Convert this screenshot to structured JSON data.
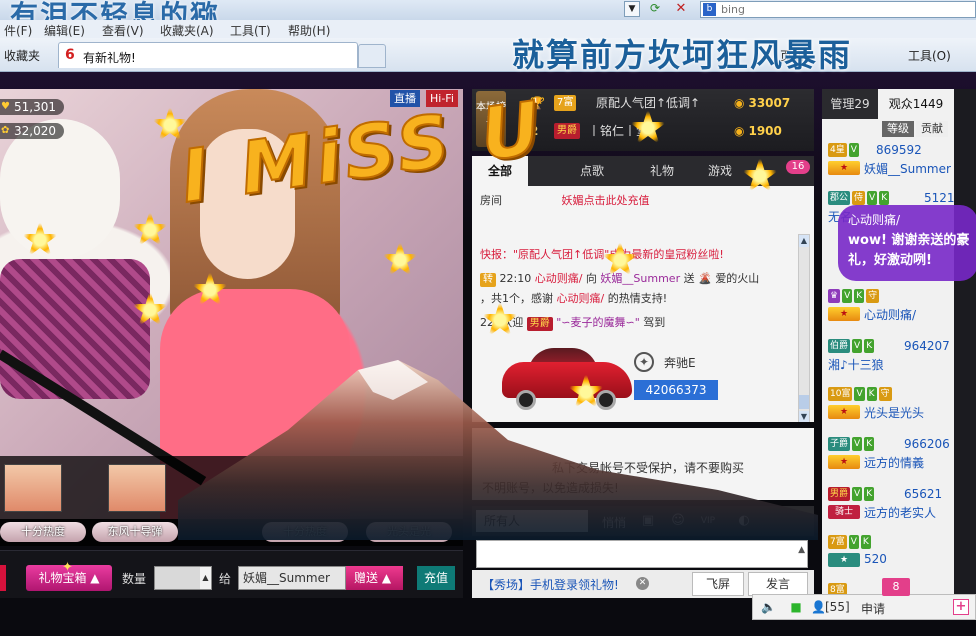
{
  "browser": {
    "window_title": "有泪不轻息的猕",
    "search_placeholder": "bing",
    "menu": [
      "编辑(E)",
      "查看(V)",
      "收藏夹(A)",
      "工具(T)",
      "帮助(H)"
    ],
    "menu_partial_first": "件(F)",
    "favorites_label": "收藏夹",
    "active_tab": "有新礼物!",
    "right_tools": [
      "页面",
      "工具(O)"
    ],
    "slogan": "就算前方坎坷狂风暴雨"
  },
  "video": {
    "viewers_a": "51,301",
    "viewers_b": "32,020",
    "live_badge": "直播",
    "hifi_badge": "Hi-Fi",
    "overlay_text": "I MiSS U"
  },
  "thumbnails": [
    {
      "label": "十分热度"
    },
    {
      "label": "东风十导弹"
    },
    {
      "label": "十分热度"
    },
    {
      "label": "光头是光"
    }
  ],
  "giftbar": {
    "gift_box_label": "礼物宝箱",
    "quantity_label": "数量",
    "to_label": "给",
    "recipient": "妖媚__Summer",
    "send_label": "赠送",
    "recharge_label": "充值"
  },
  "ranking": {
    "badge_text": "本场榜单",
    "rows": [
      {
        "num": "",
        "tag": "7富",
        "name": "原配人气团↑低调↑",
        "score": "33007"
      },
      {
        "num": "2",
        "tag": "男爵",
        "name": "丨铭仁丨堂",
        "score": "1900"
      }
    ]
  },
  "chat": {
    "tabs": [
      "全部",
      "点歌",
      "礼物",
      "游戏"
    ],
    "tab_count": "16",
    "lines": {
      "room": "房间",
      "recharge_hint": "妖媚点击此处充值",
      "flash_prefix": "快报：",
      "flash_quote": "\"原配人气团↑低调\"",
      "flash_suffix": "成为最新的皇冠粉丝啦!",
      "gift_tag": "转",
      "gift_time": "22:10",
      "gift_sender": "心动则痛/",
      "gift_to": "向",
      "gift_receiver": "妖媚__Summer",
      "gift_send": "送",
      "gift_item": "爱的火山",
      "gift_count": "，共1个，感谢",
      "gift_thanks_name": "心动则痛/",
      "gift_thanks_suffix": "的热情支持!",
      "welcome_prefix": "22:",
      "welcome_text": "欢迎",
      "welcome_tag": "男爵",
      "welcome_name": "\"∽麦子的魔舞∽\"",
      "welcome_suffix": "驾到",
      "car_name": "奔驰E",
      "car_id": "42066373"
    },
    "notice_line1": "私下交易帐号不受保护，请不要购买",
    "notice_line2": "不明账号，以免造成损失!",
    "target": "所有人",
    "whisper": "悄悄",
    "input_placeholder": "",
    "promo_link": "【秀场】手机登录领礼物!",
    "fly_label": "飞屏",
    "say_label": "发言"
  },
  "audience": {
    "tabs": [
      "管理29",
      "观众1449"
    ],
    "sort": [
      "等级",
      "贡献"
    ],
    "rows": [
      {
        "lv": "4皇",
        "num": "869592",
        "nick": "妖媚__Summer"
      },
      {
        "lv": "郡公",
        "num": "5121",
        "nick": "无名"
      },
      {
        "lv": "",
        "num": "",
        "nick": "心动则痛/"
      },
      {
        "lv": "伯爵",
        "num": "964207",
        "nick": "湘♪十三狼"
      },
      {
        "lv": "10富",
        "num": "",
        "nick": "光头是光头"
      },
      {
        "lv": "子爵",
        "num": "966206",
        "nick": "远方的情義"
      },
      {
        "lv": "男爵",
        "num": "65621",
        "nick": "远方的老实人"
      },
      {
        "lv": "7富",
        "num": "",
        "nick": "520"
      },
      {
        "lv": "8富",
        "num": "",
        "nick": ""
      }
    ],
    "bubble_who": "心动则痛/",
    "bubble_msg": "wow! 谢谢亲送的豪礼，好激动咧!"
  },
  "tray": {
    "count": "[55]",
    "apply": "申请",
    "badge": "8"
  }
}
